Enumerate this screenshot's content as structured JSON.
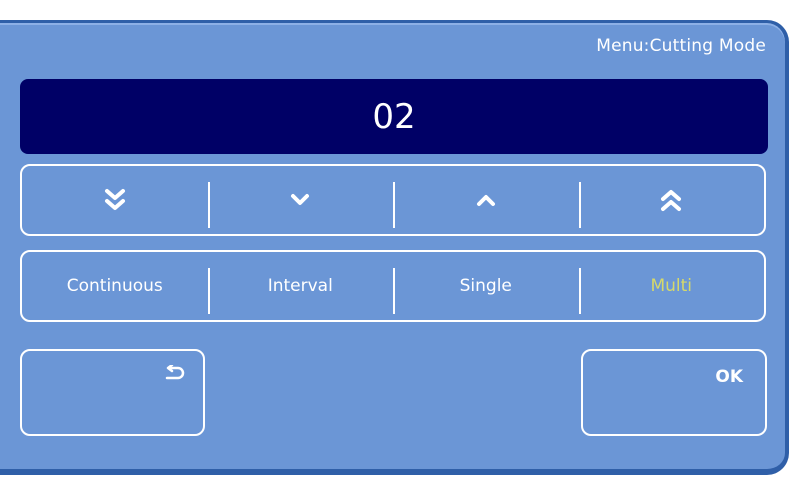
{
  "header": {
    "menu_title": "Menu:Cutting Mode"
  },
  "display": {
    "value": "02"
  },
  "arrows": [
    {
      "icon": "double-chevron-down-icon"
    },
    {
      "icon": "chevron-down-icon"
    },
    {
      "icon": "chevron-up-icon"
    },
    {
      "icon": "double-chevron-up-icon"
    }
  ],
  "modes": {
    "items": [
      "Continuous",
      "Interval",
      "Single",
      "Multi"
    ],
    "selected": "Multi"
  },
  "footer": {
    "back_icon": "return-icon",
    "ok_label": "OK"
  },
  "colors": {
    "panel": "#6b96d6",
    "display_bg": "#000066",
    "active_mode": "#d6d96a",
    "text": "#ffffff"
  }
}
